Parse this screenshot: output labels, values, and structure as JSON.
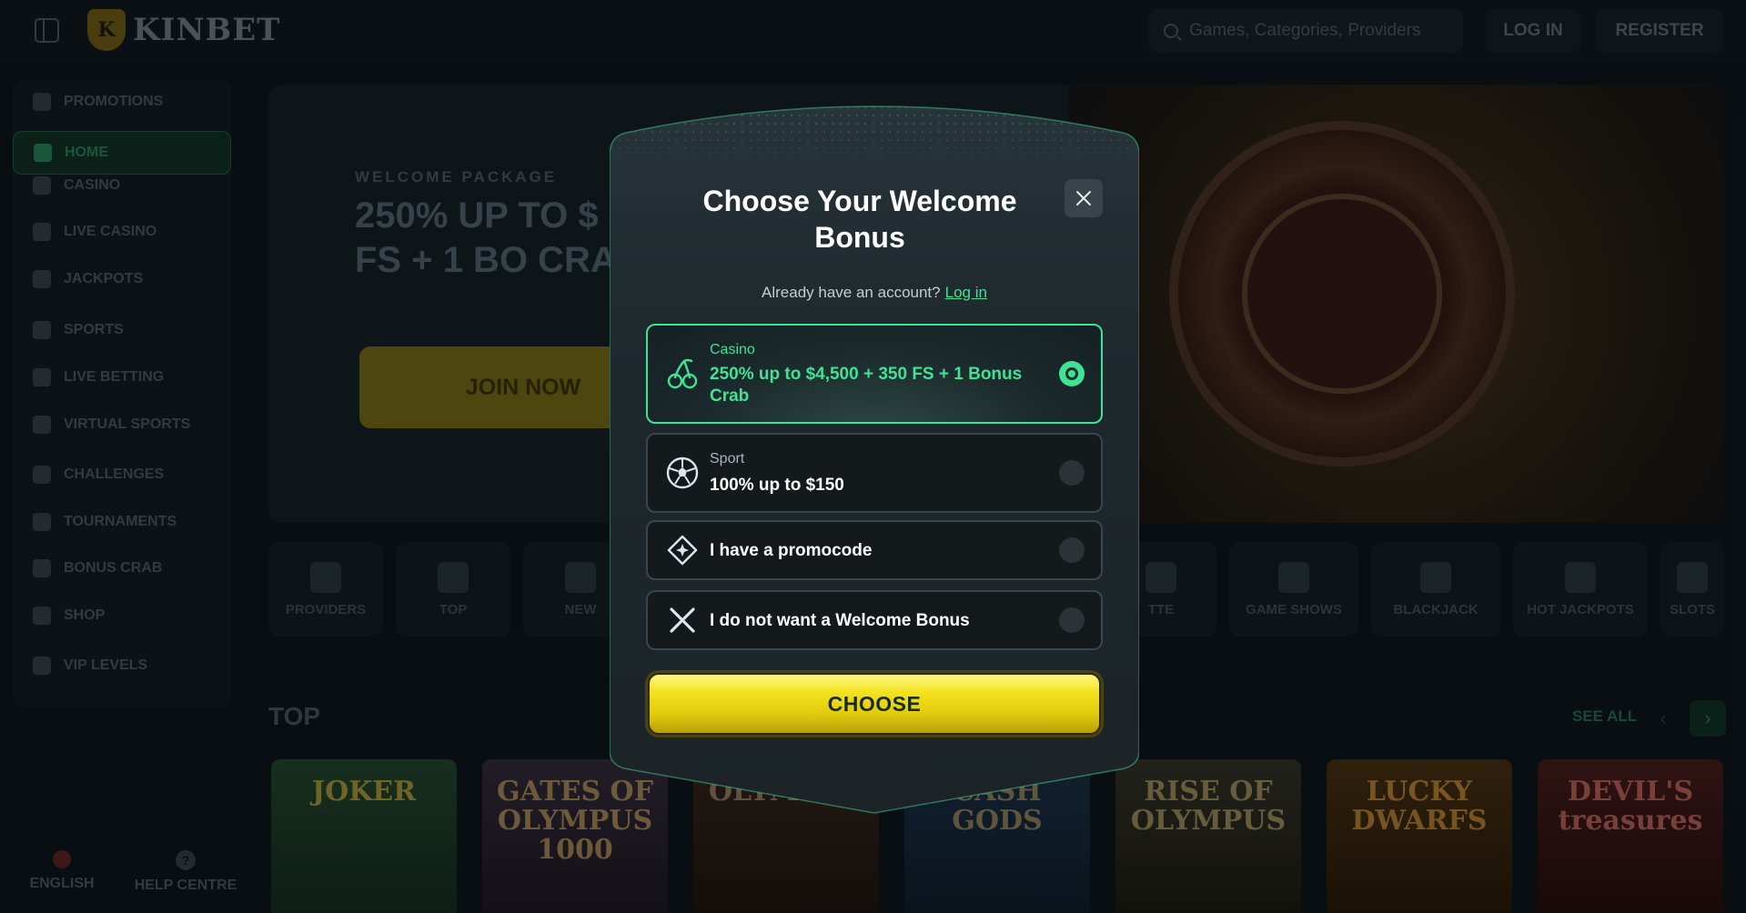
{
  "header": {
    "logo_text": "KINBET",
    "logo_mark": "K",
    "search_placeholder": "Games, Categories, Providers",
    "login_label": "LOG IN",
    "register_label": "REGISTER"
  },
  "sidebar": {
    "items": [
      {
        "label": "PROMOTIONS",
        "icon": "gift-icon"
      },
      {
        "label": "HOME",
        "icon": "home-icon",
        "active": true
      },
      {
        "label": "CASINO",
        "icon": "slot-machine-icon"
      },
      {
        "label": "LIVE CASINO",
        "icon": "card-icon"
      },
      {
        "label": "JACKPOTS",
        "icon": "clover-icon"
      },
      {
        "label": "SPORTS",
        "icon": "football-icon"
      },
      {
        "label": "LIVE BETTING",
        "icon": "live-icon"
      },
      {
        "label": "VIRTUAL SPORTS",
        "icon": "monitor-icon"
      },
      {
        "label": "CHALLENGES",
        "icon": "target-icon"
      },
      {
        "label": "TOURNAMENTS",
        "icon": "trophy-icon"
      },
      {
        "label": "BONUS CRAB",
        "icon": "crab-icon"
      },
      {
        "label": "SHOP",
        "icon": "cart-icon"
      },
      {
        "label": "VIP LEVELS",
        "icon": "diamond-icon"
      }
    ],
    "footer": {
      "language": "ENGLISH",
      "help": "HELP CENTRE",
      "help_glyph": "?"
    }
  },
  "banner": {
    "kicker": "WELCOME PACKAGE",
    "title": "250% UP TO $ 350 FS + 1 BO CRAB",
    "cta": "JOIN NOW"
  },
  "categories": [
    "PROVIDERS",
    "TOP",
    "NEW",
    "TTE",
    "GAME SHOWS",
    "BLACKJACK",
    "HOT JACKPOTS",
    "SLOTS"
  ],
  "top_section": {
    "title": "TOP",
    "see_all": "SEE ALL",
    "arrow_left": "‹",
    "arrow_right": "›",
    "games": [
      {
        "title": "JOKER",
        "color": "#2b5a35"
      },
      {
        "title": "GATES OF OLYMPUS 1000",
        "color": "#3a3442"
      },
      {
        "title": "OLYMPUS",
        "color": "#3b2c22"
      },
      {
        "title": "CASH GODS",
        "color": "#1f3a4e"
      },
      {
        "title": "RISE OF OLYMPUS",
        "color": "#3a3a30"
      },
      {
        "title": "LUCKY DWARFS",
        "color": "#4a3416"
      },
      {
        "title": "DEVIL'S treasures",
        "color": "#4a1f20"
      }
    ]
  },
  "modal": {
    "title": "Choose Your Welcome Bonus",
    "account_prompt": "Already have an account?",
    "login_link": "Log in",
    "options": [
      {
        "category": "Casino",
        "title": "250% up to $4,500 + 350 FS + 1 Bonus Crab",
        "icon": "cherries-icon",
        "selected": true
      },
      {
        "category": "Sport",
        "title": "100% up to $150",
        "icon": "soccer-ball-icon",
        "selected": false
      },
      {
        "category": "",
        "title": "I have a promocode",
        "icon": "promo-ticket-icon",
        "selected": false
      },
      {
        "category": "",
        "title": "I do not want a Welcome Bonus",
        "icon": "cross-icon",
        "selected": false
      }
    ],
    "choose_label": "CHOOSE"
  },
  "colors": {
    "accent_green": "#3ee394",
    "button_yellow": "#f3e21c",
    "modal_bg": "#1e272c",
    "page_bg": "#0b1216"
  }
}
